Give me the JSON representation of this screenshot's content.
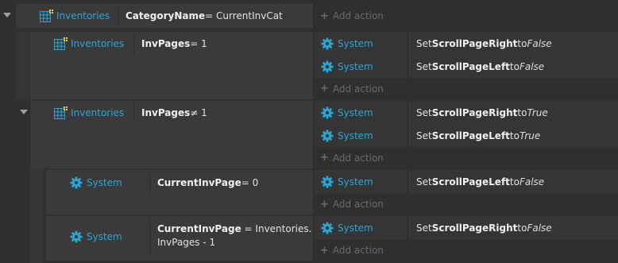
{
  "add_action_label": "Add action",
  "colors": {
    "object_name": "#2aa6d6",
    "add_action": "#6a6a6a"
  },
  "events": [
    {
      "object": "Inventories",
      "object_icon": "sprite-grid-icon",
      "cond_name": "CategoryName",
      "cond_rest": " = CurrentInvCat",
      "actions": []
    },
    {
      "object": "Inventories",
      "object_icon": "sprite-grid-icon",
      "cond_name": "InvPages",
      "cond_rest": " = 1",
      "actions": [
        {
          "object": "System",
          "icon": "gear-icon",
          "prefix": "Set ",
          "var": "ScrollPageRight",
          "mid": " to ",
          "val": "False"
        },
        {
          "object": "System",
          "icon": "gear-icon",
          "prefix": "Set ",
          "var": "ScrollPageLeft",
          "mid": " to ",
          "val": "False"
        }
      ]
    },
    {
      "object": "Inventories",
      "object_icon": "sprite-grid-icon",
      "cond_name": "InvPages",
      "cond_rest": " ≠ 1",
      "actions": [
        {
          "object": "System",
          "icon": "gear-icon",
          "prefix": "Set ",
          "var": "ScrollPageRight",
          "mid": " to ",
          "val": "True"
        },
        {
          "object": "System",
          "icon": "gear-icon",
          "prefix": "Set ",
          "var": "ScrollPageLeft",
          "mid": " to ",
          "val": "True"
        }
      ]
    },
    {
      "object": "System",
      "object_icon": "gear-icon",
      "cond_name": "CurrentInvPage",
      "cond_rest": " = 0",
      "actions": [
        {
          "object": "System",
          "icon": "gear-icon",
          "prefix": "Set ",
          "var": "ScrollPageLeft",
          "mid": " to ",
          "val": "False"
        }
      ]
    },
    {
      "object": "System",
      "object_icon": "gear-icon",
      "cond_name": "CurrentInvPage",
      "cond_rest": " = Inventories.",
      "cond_line2": "InvPages - 1",
      "actions": [
        {
          "object": "System",
          "icon": "gear-icon",
          "prefix": "Set ",
          "var": "ScrollPageRight",
          "mid": " to ",
          "val": "False"
        }
      ]
    }
  ]
}
